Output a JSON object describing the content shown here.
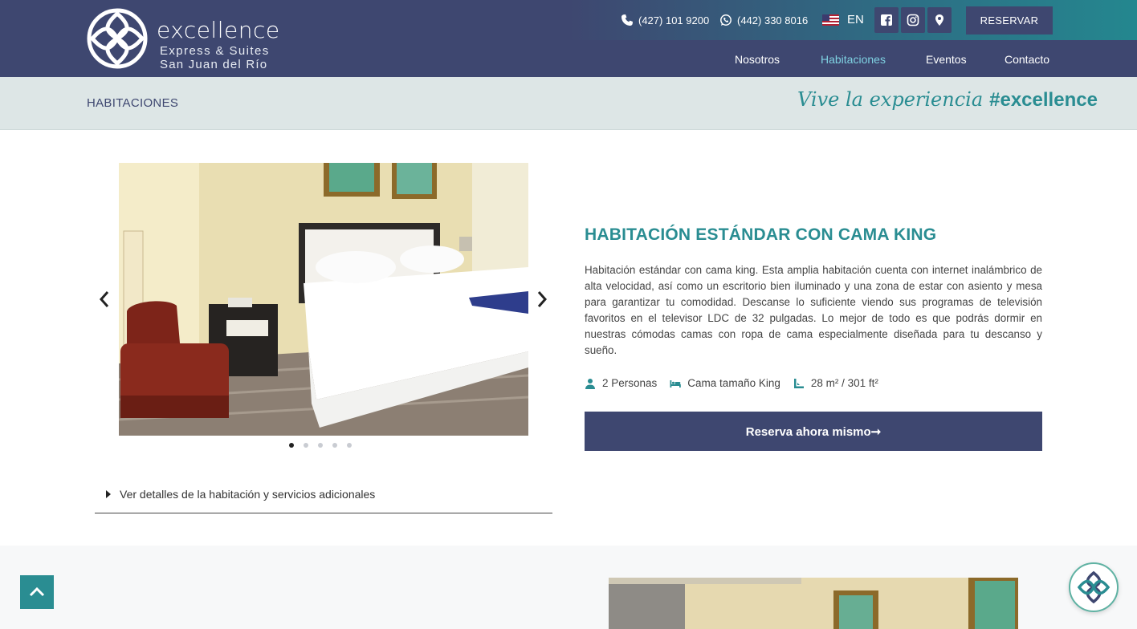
{
  "brand": {
    "name": "excellence",
    "line1": "Express & Suites",
    "line2": "San Juan del Río"
  },
  "contact": {
    "phone": "(427) 101 9200",
    "whatsapp": "(442) 330 8016"
  },
  "language": {
    "label": "EN",
    "flag_icon": "us-flag-icon"
  },
  "social_icons": [
    "facebook-icon",
    "instagram-icon",
    "location-pin-icon"
  ],
  "header": {
    "reserve_label": "RESERVAR"
  },
  "nav": {
    "items": [
      {
        "label": "Nosotros",
        "active": false
      },
      {
        "label": "Habitaciones",
        "active": true
      },
      {
        "label": "Eventos",
        "active": false
      },
      {
        "label": "Contacto",
        "active": false
      }
    ]
  },
  "banner": {
    "title": "HABITACIONES",
    "tagline_script": "Vive la experiencia",
    "tagline_hashtag": "#excellence"
  },
  "gallery": {
    "slide_count": 5,
    "active_slide": 1
  },
  "room": {
    "title": "HABITACIÓN ESTÁNDAR CON CAMA KING",
    "description": "Habitación estándar con cama king. Esta amplia habitación cuenta con internet inalámbrico de alta velocidad, así como un escritorio bien iluminado y una zona de estar con asiento y mesa para garantizar tu comodidad. Descanse lo suficiente viendo sus programas de televisión favoritos en el televisor LDC de 32 pulgadas. Lo mejor de todo es que podrás dormir en nuestras cómodas camas con ropa de cama especialmente diseñada para tu descanso y sueño.",
    "features": [
      {
        "icon": "person-icon",
        "label": "2 Personas"
      },
      {
        "icon": "bed-icon",
        "label": "Cama tamaño King"
      },
      {
        "icon": "area-icon",
        "label": "28 m² / 301 ft²"
      }
    ],
    "book_label": "Reserva ahora mismo➞"
  },
  "details": {
    "label": "Ver detalles de la habitación y servicios adicionales"
  },
  "colors": {
    "brand_navy": "#3e4770",
    "accent_teal": "#2a8d92",
    "nav_active": "#7fd2e2",
    "banner_bg": "#dde6e6"
  }
}
